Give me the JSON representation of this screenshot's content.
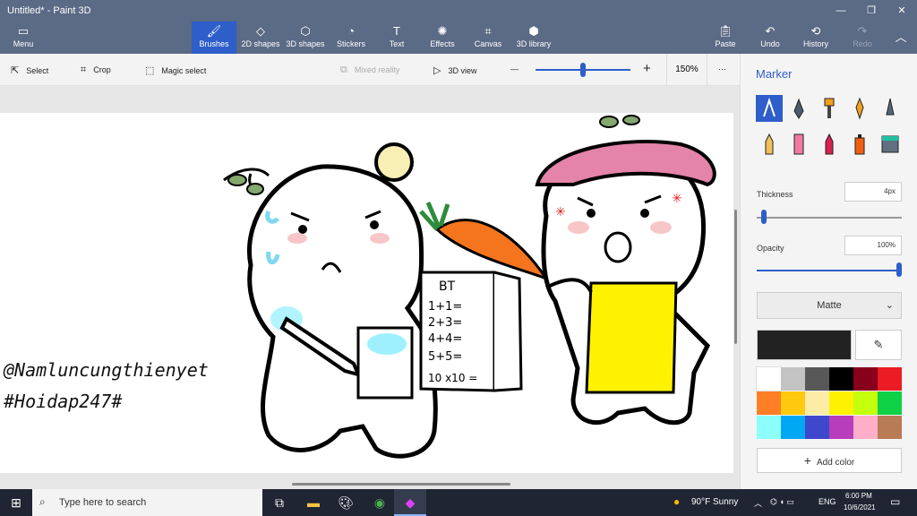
{
  "window": {
    "title": "Untitled* - Paint 3D",
    "min": "—",
    "max": "❐",
    "close": "✕"
  },
  "ribbon": {
    "menu": "Menu",
    "tabs": [
      "Brushes",
      "2D shapes",
      "3D shapes",
      "Stickers",
      "Text",
      "Effects",
      "Canvas",
      "3D library"
    ],
    "paste": "Paste",
    "undo": "Undo",
    "history": "History",
    "redo": "Redo"
  },
  "toolbar": {
    "select": "Select",
    "crop": "Crop",
    "magic_select": "Magic select",
    "mixed_reality": "Mixed reality",
    "view_3d": "3D view",
    "zoom_minus": "—",
    "zoom_plus": "+",
    "zoom": "150%",
    "more": "···",
    "zoom_level_pct": 50
  },
  "canvas": {
    "watermark1": "@Namluncungthienyet",
    "watermark2": "#Hoidap247#",
    "book_title": "BT",
    "math_lines": [
      "1+1=",
      "2+3=",
      "4+4=",
      "5+5=",
      "10 x10 ="
    ]
  },
  "panel": {
    "title": "Marker",
    "thickness_label": "Thickness",
    "thickness_value": "4px",
    "thickness_pct": 3,
    "opacity_label": "Opacity",
    "opacity_value": "100%",
    "opacity_pct": 100,
    "finish": "Matte",
    "current_color": "#222222",
    "add_color": "Add color",
    "palette": [
      "#ffffff",
      "#c3c3c3",
      "#585858",
      "#000000",
      "#88001b",
      "#ec1c24",
      "#ff7f27",
      "#ffc90e",
      "#fdeca6",
      "#fff200",
      "#c4ff0e",
      "#0ed145",
      "#8cfffb",
      "#00a8f3",
      "#3f48cc",
      "#b83dba",
      "#ffaec8",
      "#b97a56"
    ]
  },
  "taskbar": {
    "search_placeholder": "Type here to search",
    "weather": "90°F  Sunny",
    "lang": "ENG",
    "time": "6:00 PM",
    "date": "10/6/2021"
  }
}
